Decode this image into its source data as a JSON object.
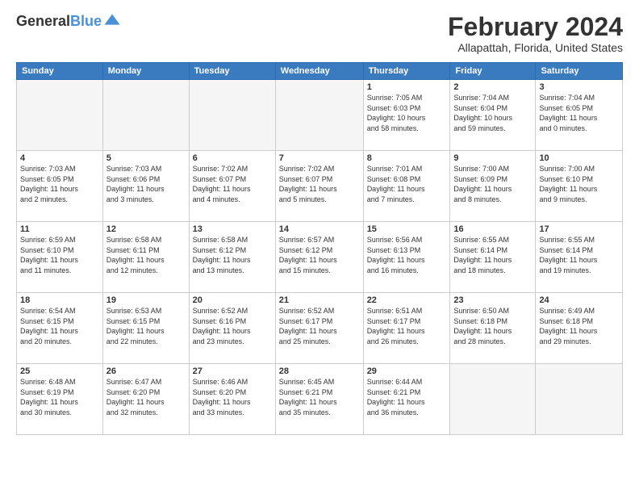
{
  "header": {
    "logo_line1": "General",
    "logo_line2": "Blue",
    "title": "February 2024",
    "subtitle": "Allapattah, Florida, United States"
  },
  "weekdays": [
    "Sunday",
    "Monday",
    "Tuesday",
    "Wednesday",
    "Thursday",
    "Friday",
    "Saturday"
  ],
  "weeks": [
    [
      {
        "num": "",
        "info": ""
      },
      {
        "num": "",
        "info": ""
      },
      {
        "num": "",
        "info": ""
      },
      {
        "num": "",
        "info": ""
      },
      {
        "num": "1",
        "info": "Sunrise: 7:05 AM\nSunset: 6:03 PM\nDaylight: 10 hours\nand 58 minutes."
      },
      {
        "num": "2",
        "info": "Sunrise: 7:04 AM\nSunset: 6:04 PM\nDaylight: 10 hours\nand 59 minutes."
      },
      {
        "num": "3",
        "info": "Sunrise: 7:04 AM\nSunset: 6:05 PM\nDaylight: 11 hours\nand 0 minutes."
      }
    ],
    [
      {
        "num": "4",
        "info": "Sunrise: 7:03 AM\nSunset: 6:05 PM\nDaylight: 11 hours\nand 2 minutes."
      },
      {
        "num": "5",
        "info": "Sunrise: 7:03 AM\nSunset: 6:06 PM\nDaylight: 11 hours\nand 3 minutes."
      },
      {
        "num": "6",
        "info": "Sunrise: 7:02 AM\nSunset: 6:07 PM\nDaylight: 11 hours\nand 4 minutes."
      },
      {
        "num": "7",
        "info": "Sunrise: 7:02 AM\nSunset: 6:07 PM\nDaylight: 11 hours\nand 5 minutes."
      },
      {
        "num": "8",
        "info": "Sunrise: 7:01 AM\nSunset: 6:08 PM\nDaylight: 11 hours\nand 7 minutes."
      },
      {
        "num": "9",
        "info": "Sunrise: 7:00 AM\nSunset: 6:09 PM\nDaylight: 11 hours\nand 8 minutes."
      },
      {
        "num": "10",
        "info": "Sunrise: 7:00 AM\nSunset: 6:10 PM\nDaylight: 11 hours\nand 9 minutes."
      }
    ],
    [
      {
        "num": "11",
        "info": "Sunrise: 6:59 AM\nSunset: 6:10 PM\nDaylight: 11 hours\nand 11 minutes."
      },
      {
        "num": "12",
        "info": "Sunrise: 6:58 AM\nSunset: 6:11 PM\nDaylight: 11 hours\nand 12 minutes."
      },
      {
        "num": "13",
        "info": "Sunrise: 6:58 AM\nSunset: 6:12 PM\nDaylight: 11 hours\nand 13 minutes."
      },
      {
        "num": "14",
        "info": "Sunrise: 6:57 AM\nSunset: 6:12 PM\nDaylight: 11 hours\nand 15 minutes."
      },
      {
        "num": "15",
        "info": "Sunrise: 6:56 AM\nSunset: 6:13 PM\nDaylight: 11 hours\nand 16 minutes."
      },
      {
        "num": "16",
        "info": "Sunrise: 6:55 AM\nSunset: 6:14 PM\nDaylight: 11 hours\nand 18 minutes."
      },
      {
        "num": "17",
        "info": "Sunrise: 6:55 AM\nSunset: 6:14 PM\nDaylight: 11 hours\nand 19 minutes."
      }
    ],
    [
      {
        "num": "18",
        "info": "Sunrise: 6:54 AM\nSunset: 6:15 PM\nDaylight: 11 hours\nand 20 minutes."
      },
      {
        "num": "19",
        "info": "Sunrise: 6:53 AM\nSunset: 6:15 PM\nDaylight: 11 hours\nand 22 minutes."
      },
      {
        "num": "20",
        "info": "Sunrise: 6:52 AM\nSunset: 6:16 PM\nDaylight: 11 hours\nand 23 minutes."
      },
      {
        "num": "21",
        "info": "Sunrise: 6:52 AM\nSunset: 6:17 PM\nDaylight: 11 hours\nand 25 minutes."
      },
      {
        "num": "22",
        "info": "Sunrise: 6:51 AM\nSunset: 6:17 PM\nDaylight: 11 hours\nand 26 minutes."
      },
      {
        "num": "23",
        "info": "Sunrise: 6:50 AM\nSunset: 6:18 PM\nDaylight: 11 hours\nand 28 minutes."
      },
      {
        "num": "24",
        "info": "Sunrise: 6:49 AM\nSunset: 6:18 PM\nDaylight: 11 hours\nand 29 minutes."
      }
    ],
    [
      {
        "num": "25",
        "info": "Sunrise: 6:48 AM\nSunset: 6:19 PM\nDaylight: 11 hours\nand 30 minutes."
      },
      {
        "num": "26",
        "info": "Sunrise: 6:47 AM\nSunset: 6:20 PM\nDaylight: 11 hours\nand 32 minutes."
      },
      {
        "num": "27",
        "info": "Sunrise: 6:46 AM\nSunset: 6:20 PM\nDaylight: 11 hours\nand 33 minutes."
      },
      {
        "num": "28",
        "info": "Sunrise: 6:45 AM\nSunset: 6:21 PM\nDaylight: 11 hours\nand 35 minutes."
      },
      {
        "num": "29",
        "info": "Sunrise: 6:44 AM\nSunset: 6:21 PM\nDaylight: 11 hours\nand 36 minutes."
      },
      {
        "num": "",
        "info": ""
      },
      {
        "num": "",
        "info": ""
      }
    ]
  ]
}
